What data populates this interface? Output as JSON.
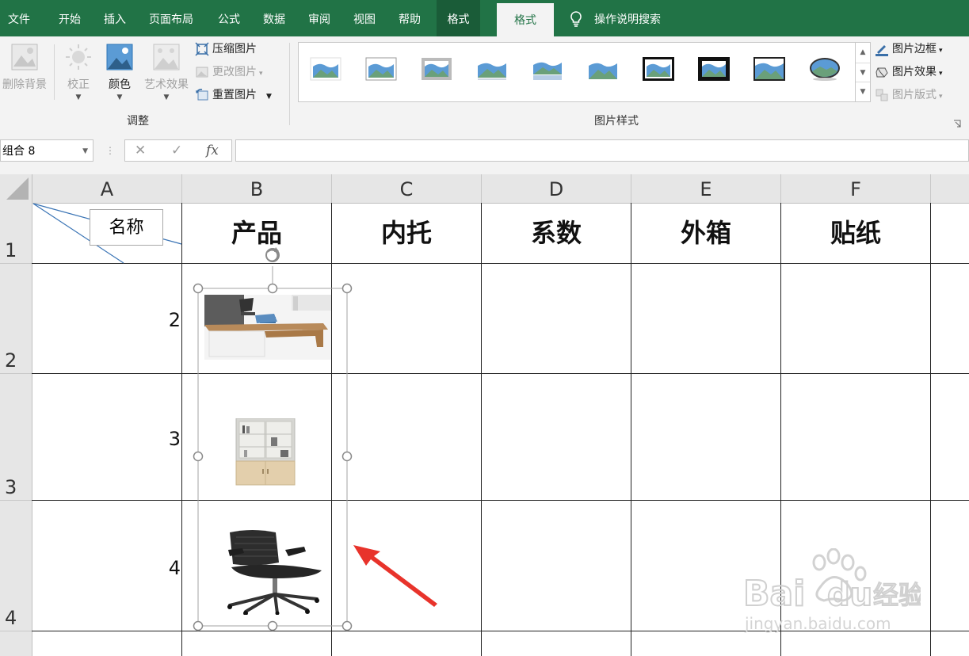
{
  "tabs": [
    {
      "label": "文件",
      "state": "normal"
    },
    {
      "label": "开始",
      "state": "normal"
    },
    {
      "label": "插入",
      "state": "normal"
    },
    {
      "label": "页面布局",
      "state": "normal"
    },
    {
      "label": "公式",
      "state": "normal"
    },
    {
      "label": "数据",
      "state": "normal"
    },
    {
      "label": "审阅",
      "state": "normal"
    },
    {
      "label": "视图",
      "state": "normal"
    },
    {
      "label": "帮助",
      "state": "normal"
    },
    {
      "label": "格式",
      "state": "context"
    },
    {
      "label": "格式",
      "state": "active"
    }
  ],
  "tell_me": "操作说明搜索",
  "adjust": {
    "remove_bg": "删除背景",
    "correct": "校正",
    "color": "颜色",
    "artistic": "艺术效果",
    "compress": "压缩图片",
    "change": "更改图片",
    "reset": "重置图片",
    "group_label": "调整"
  },
  "styles": {
    "group_label": "图片样式",
    "border": "图片边框",
    "effects": "图片效果",
    "layout": "图片版式"
  },
  "formula_bar": {
    "name_box": "组合 8",
    "fx": "fx",
    "value": ""
  },
  "columns": [
    "A",
    "B",
    "C",
    "D",
    "E",
    "F"
  ],
  "rows": [
    "1",
    "2",
    "3",
    "4"
  ],
  "sheet": {
    "a1_label": "名称",
    "headers": [
      "产品",
      "内托",
      "系数",
      "外箱",
      "贴纸"
    ],
    "row_values": [
      "2",
      "3",
      "4"
    ]
  },
  "images": [
    {
      "name": "office-desk",
      "subject": "desk"
    },
    {
      "name": "bookcase",
      "subject": "cabinet"
    },
    {
      "name": "office-chair",
      "subject": "chair"
    }
  ],
  "watermark": {
    "brand": "Baidu经验",
    "url": "jingyan.baidu.com"
  },
  "colors": {
    "accent": "#217346",
    "arrow": "#e8332b",
    "selection": "#9a9a9a"
  }
}
